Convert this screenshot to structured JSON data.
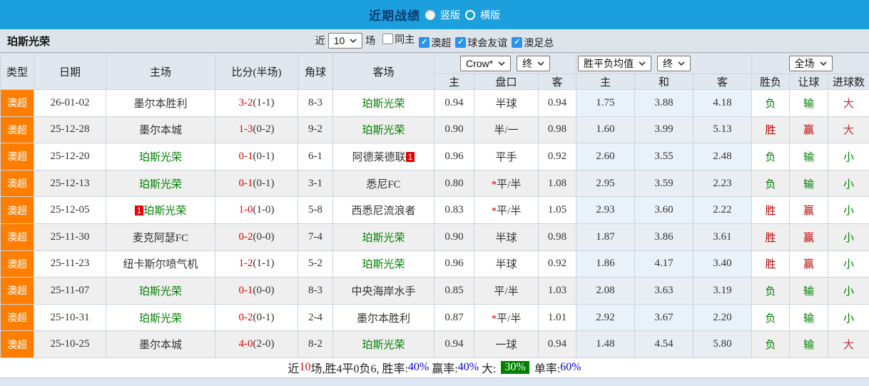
{
  "colors": {
    "topbar_blue": "#1ba0dd",
    "title_navy": "#0d3a70",
    "league_orange": "#ff7e00",
    "win_red": "#c00000",
    "loss_green": "#008000",
    "score_red": "#e60000",
    "link_blue": "#0000ee",
    "highlight_green_bg": "#008000",
    "checkbox_blue": "#2a93ee",
    "mean_col_blue": "#e9f2fb"
  },
  "title_bar": {
    "title": "近期战绩",
    "radio_vertical": "竖版",
    "radio_horizontal": "横版"
  },
  "toolbar": {
    "team": "珀斯光荣",
    "recent_label": "近",
    "recent_value": "10",
    "matches_label": "场",
    "filters": [
      {
        "label": "同主",
        "checked": false
      },
      {
        "label": "澳超",
        "checked": true
      },
      {
        "label": "球会友谊",
        "checked": true
      },
      {
        "label": "澳足总",
        "checked": true
      }
    ]
  },
  "table": {
    "static_headers": [
      "类型",
      "日期",
      "主场",
      "比分(半场)",
      "角球",
      "客场"
    ],
    "dropdowns": {
      "odds_source": "Crow*",
      "odds_time": "终",
      "mean_source": "胜平负均值",
      "mean_time": "终",
      "scope": "全场"
    },
    "odds_subheaders": [
      "主",
      "盘口",
      "客"
    ],
    "mean_subheaders": [
      "主",
      "和",
      "客"
    ],
    "result_subheaders": [
      "胜负",
      "让球",
      "进球数"
    ],
    "rows": [
      {
        "type": "澳超",
        "date": "26-01-02",
        "home": {
          "name": "墨尔本胜利",
          "self": false,
          "badge": "",
          "badge_pos": ""
        },
        "score_ft": "3-2",
        "score_ht": "(1-1)",
        "corner": "8-3",
        "away": {
          "name": "珀斯光荣",
          "self": true,
          "badge": "",
          "badge_pos": ""
        },
        "odds_home": "0.94",
        "handicap_star": false,
        "handicap": "半球",
        "odds_away": "0.94",
        "mean_home": "1.75",
        "mean_draw": "3.88",
        "mean_away": "4.18",
        "result": "负",
        "result_win": false,
        "handicap_result": "输",
        "handicap_win": false,
        "goals": "大",
        "goals_big": true
      },
      {
        "type": "澳超",
        "date": "25-12-28",
        "home": {
          "name": "墨尔本城",
          "self": false,
          "badge": "",
          "badge_pos": ""
        },
        "score_ft": "1-3",
        "score_ht": "(0-2)",
        "corner": "9-2",
        "away": {
          "name": "珀斯光荣",
          "self": true,
          "badge": "",
          "badge_pos": ""
        },
        "odds_home": "0.90",
        "handicap_star": false,
        "handicap": "半/一",
        "odds_away": "0.98",
        "mean_home": "1.60",
        "mean_draw": "3.99",
        "mean_away": "5.13",
        "result": "胜",
        "result_win": true,
        "handicap_result": "赢",
        "handicap_win": true,
        "goals": "大",
        "goals_big": true
      },
      {
        "type": "澳超",
        "date": "25-12-20",
        "home": {
          "name": "珀斯光荣",
          "self": true,
          "badge": "",
          "badge_pos": ""
        },
        "score_ft": "0-1",
        "score_ht": "(0-1)",
        "corner": "6-1",
        "away": {
          "name": "阿德莱德联",
          "self": false,
          "badge": "1",
          "badge_pos": "after"
        },
        "odds_home": "0.96",
        "handicap_star": false,
        "handicap": "平手",
        "odds_away": "0.92",
        "mean_home": "2.60",
        "mean_draw": "3.55",
        "mean_away": "2.48",
        "result": "负",
        "result_win": false,
        "handicap_result": "输",
        "handicap_win": false,
        "goals": "小",
        "goals_big": false
      },
      {
        "type": "澳超",
        "date": "25-12-13",
        "home": {
          "name": "珀斯光荣",
          "self": true,
          "badge": "",
          "badge_pos": ""
        },
        "score_ft": "0-1",
        "score_ht": "(0-1)",
        "corner": "3-1",
        "away": {
          "name": "悉尼FC",
          "self": false,
          "badge": "",
          "badge_pos": ""
        },
        "odds_home": "0.80",
        "handicap_star": true,
        "handicap": "平/半",
        "odds_away": "1.08",
        "mean_home": "2.95",
        "mean_draw": "3.59",
        "mean_away": "2.23",
        "result": "负",
        "result_win": false,
        "handicap_result": "输",
        "handicap_win": false,
        "goals": "小",
        "goals_big": false
      },
      {
        "type": "澳超",
        "date": "25-12-05",
        "home": {
          "name": "珀斯光荣",
          "self": true,
          "badge": "1",
          "badge_pos": "before"
        },
        "score_ft": "1-0",
        "score_ht": "(1-0)",
        "corner": "5-8",
        "away": {
          "name": "西悉尼流浪者",
          "self": false,
          "badge": "",
          "badge_pos": ""
        },
        "odds_home": "0.83",
        "handicap_star": true,
        "handicap": "平/半",
        "odds_away": "1.05",
        "mean_home": "2.93",
        "mean_draw": "3.60",
        "mean_away": "2.22",
        "result": "胜",
        "result_win": true,
        "handicap_result": "赢",
        "handicap_win": true,
        "goals": "小",
        "goals_big": false
      },
      {
        "type": "澳超",
        "date": "25-11-30",
        "home": {
          "name": "麦克阿瑟FC",
          "self": false,
          "badge": "",
          "badge_pos": ""
        },
        "score_ft": "0-2",
        "score_ht": "(0-0)",
        "corner": "7-4",
        "away": {
          "name": "珀斯光荣",
          "self": true,
          "badge": "",
          "badge_pos": ""
        },
        "odds_home": "0.90",
        "handicap_star": false,
        "handicap": "半球",
        "odds_away": "0.98",
        "mean_home": "1.87",
        "mean_draw": "3.86",
        "mean_away": "3.61",
        "result": "胜",
        "result_win": true,
        "handicap_result": "赢",
        "handicap_win": true,
        "goals": "小",
        "goals_big": false
      },
      {
        "type": "澳超",
        "date": "25-11-23",
        "home": {
          "name": "纽卡斯尔喷气机",
          "self": false,
          "badge": "",
          "badge_pos": ""
        },
        "score_ft": "1-2",
        "score_ht": "(1-1)",
        "corner": "5-2",
        "away": {
          "name": "珀斯光荣",
          "self": true,
          "badge": "",
          "badge_pos": ""
        },
        "odds_home": "0.96",
        "handicap_star": false,
        "handicap": "半球",
        "odds_away": "0.92",
        "mean_home": "1.86",
        "mean_draw": "4.17",
        "mean_away": "3.40",
        "result": "胜",
        "result_win": true,
        "handicap_result": "赢",
        "handicap_win": true,
        "goals": "小",
        "goals_big": false
      },
      {
        "type": "澳超",
        "date": "25-11-07",
        "home": {
          "name": "珀斯光荣",
          "self": true,
          "badge": "",
          "badge_pos": ""
        },
        "score_ft": "0-1",
        "score_ht": "(0-0)",
        "corner": "8-3",
        "away": {
          "name": "中央海岸水手",
          "self": false,
          "badge": "",
          "badge_pos": ""
        },
        "odds_home": "0.85",
        "handicap_star": false,
        "handicap": "平/半",
        "odds_away": "1.03",
        "mean_home": "2.08",
        "mean_draw": "3.63",
        "mean_away": "3.19",
        "result": "负",
        "result_win": false,
        "handicap_result": "输",
        "handicap_win": false,
        "goals": "小",
        "goals_big": false
      },
      {
        "type": "澳超",
        "date": "25-10-31",
        "home": {
          "name": "珀斯光荣",
          "self": true,
          "badge": "",
          "badge_pos": ""
        },
        "score_ft": "0-2",
        "score_ht": "(0-1)",
        "corner": "2-4",
        "away": {
          "name": "墨尔本胜利",
          "self": false,
          "badge": "",
          "badge_pos": ""
        },
        "odds_home": "0.87",
        "handicap_star": true,
        "handicap": "平/半",
        "odds_away": "1.01",
        "mean_home": "2.92",
        "mean_draw": "3.67",
        "mean_away": "2.20",
        "result": "负",
        "result_win": false,
        "handicap_result": "输",
        "handicap_win": false,
        "goals": "小",
        "goals_big": false
      },
      {
        "type": "澳超",
        "date": "25-10-25",
        "home": {
          "name": "墨尔本城",
          "self": false,
          "badge": "",
          "badge_pos": ""
        },
        "score_ft": "4-0",
        "score_ht": "(2-0)",
        "corner": "8-2",
        "away": {
          "name": "珀斯光荣",
          "self": true,
          "badge": "",
          "badge_pos": ""
        },
        "odds_home": "0.94",
        "handicap_star": false,
        "handicap": "一球",
        "odds_away": "0.94",
        "mean_home": "1.48",
        "mean_draw": "4.54",
        "mean_away": "5.80",
        "result": "负",
        "result_win": false,
        "handicap_result": "输",
        "handicap_win": false,
        "goals": "大",
        "goals_big": true
      }
    ]
  },
  "summary": {
    "segments": [
      {
        "text": "近",
        "cls": ""
      },
      {
        "text": "10",
        "cls": "red"
      },
      {
        "text": "场,胜4平0负6, 胜率:",
        "cls": ""
      },
      {
        "text": "40%",
        "cls": "blue"
      },
      {
        "text": " 赢率:",
        "cls": ""
      },
      {
        "text": "40%",
        "cls": "blue"
      },
      {
        "text": " 大: ",
        "cls": ""
      },
      {
        "text": "30%",
        "cls": "greenbg"
      },
      {
        "text": " 单率:",
        "cls": ""
      },
      {
        "text": "60%",
        "cls": "blue"
      }
    ]
  }
}
